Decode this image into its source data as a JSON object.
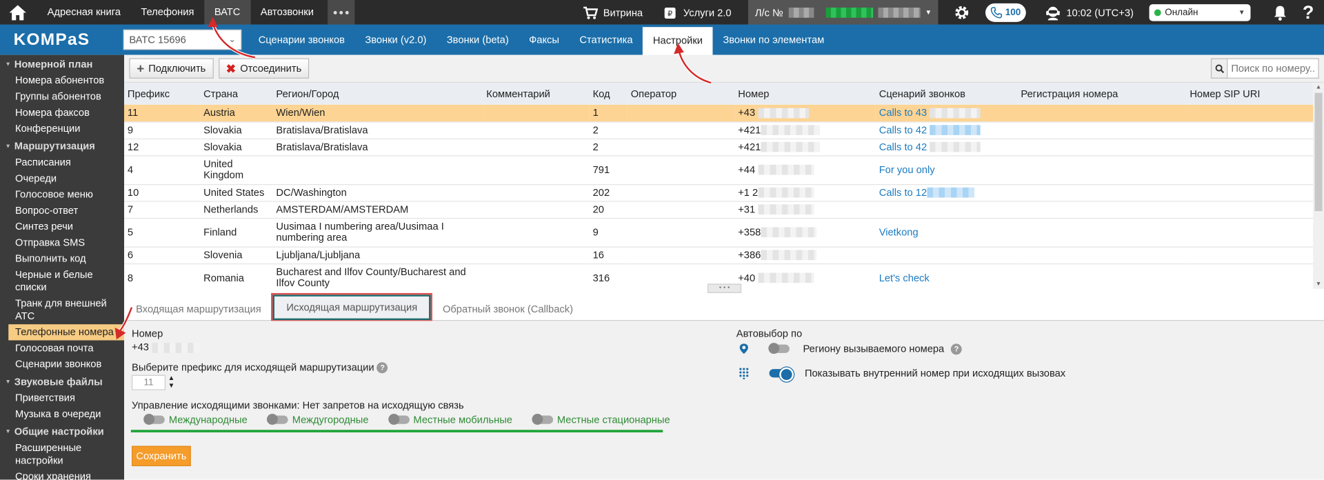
{
  "topbar": {
    "nav": [
      "Адресная книга",
      "Телефония",
      "ВАТС",
      "Автозвонки"
    ],
    "active_nav": "ВАТС",
    "vitrina": "Витрина",
    "services": "Услуги 2.0",
    "account_label": "Л/с №",
    "calls_count": "100",
    "time": "10:02 (UTC+3)",
    "status": "Онлайн"
  },
  "secbar": {
    "logo": "KOMPaS",
    "vatc_select": "ВАТС 15696",
    "tabs": [
      "Сценарии звонков",
      "Звонки (v2.0)",
      "Звонки (beta)",
      "Факсы",
      "Статистика",
      "Настройки",
      "Звонки по элементам"
    ],
    "active_tab": "Настройки"
  },
  "sidebar": {
    "sections": [
      {
        "title": "Номерной план",
        "items": [
          "Номера абонентов",
          "Группы абонентов",
          "Номера факсов",
          "Конференции"
        ]
      },
      {
        "title": "Маршрутизация",
        "items": [
          "Расписания",
          "Очереди",
          "Голосовое меню",
          "Вопрос-ответ",
          "Синтез речи",
          "Отправка SMS",
          "Выполнить код",
          "Черные и белые списки",
          "Транк для внешней АТС",
          "Телефонные номера",
          "Голосовая почта",
          "Сценарии звонков"
        ]
      },
      {
        "title": "Звуковые файлы",
        "items": [
          "Приветствия",
          "Музыка в очереди"
        ]
      },
      {
        "title": "Общие настройки",
        "items": [
          "Расширенные настройки",
          "Сроки хранения"
        ]
      }
    ],
    "active_item": "Телефонные номера"
  },
  "toolbar": {
    "connect": "Подключить",
    "disconnect": "Отсоединить",
    "search_placeholder": "Поиск по номеру..."
  },
  "table": {
    "columns": [
      "Префикс",
      "Страна",
      "Регион/Город",
      "Комментарий",
      "Код",
      "Оператор",
      "Номер",
      "Сценарий звонков",
      "Регистрация номера",
      "Номер SIP URI"
    ],
    "rows": [
      {
        "prefix": "11",
        "country": "Austria",
        "region": "Wien/Wien",
        "comment": "",
        "code": "1",
        "operator": "",
        "number": "+43",
        "scenario": "Calls to 43",
        "selected": true
      },
      {
        "prefix": "9",
        "country": "Slovakia",
        "region": "Bratislava/Bratislava",
        "comment": "",
        "code": "2",
        "operator": "",
        "number": "+421",
        "scenario": "Calls to 42",
        "selected": false
      },
      {
        "prefix": "12",
        "country": "Slovakia",
        "region": "Bratislava/Bratislava",
        "comment": "",
        "code": "2",
        "operator": "",
        "number": "+421",
        "scenario": "Calls to 42",
        "selected": false
      },
      {
        "prefix": "4",
        "country": "United Kingdom",
        "region": "",
        "comment": "",
        "code": "791",
        "operator": "",
        "number": "+44",
        "scenario": "For you only",
        "selected": false
      },
      {
        "prefix": "10",
        "country": "United States",
        "region": "DC/Washington",
        "comment": "",
        "code": "202",
        "operator": "",
        "number": "+1 2",
        "scenario": "Calls to 12",
        "selected": false
      },
      {
        "prefix": "7",
        "country": "Netherlands",
        "region": "AMSTERDAM/AMSTERDAM",
        "comment": "",
        "code": "20",
        "operator": "",
        "number": "+31",
        "scenario": "",
        "selected": false
      },
      {
        "prefix": "5",
        "country": "Finland",
        "region": "Uusimaa I numbering area/Uusimaa I numbering area",
        "comment": "",
        "code": "9",
        "operator": "",
        "number": "+358",
        "scenario": "Vietkong",
        "selected": false
      },
      {
        "prefix": "6",
        "country": "Slovenia",
        "region": "Ljubljana/Ljubljana",
        "comment": "",
        "code": "16",
        "operator": "",
        "number": "+386",
        "scenario": "",
        "selected": false
      },
      {
        "prefix": "8",
        "country": "Romania",
        "region": "Bucharest and Ilfov County/Bucharest and Ilfov County",
        "comment": "",
        "code": "316",
        "operator": "",
        "number": "+40",
        "scenario": "Let's check",
        "selected": false
      }
    ]
  },
  "tabs": {
    "items": [
      "Входящая маршрутизация",
      "Исходящая маршрутизация",
      "Обратный звонок (Callback)"
    ],
    "active": "Исходящая маршрутизация"
  },
  "form": {
    "number_label": "Номер",
    "number_value": "+43",
    "prefix_label": "Выберите префикс для исходящей маршрутизации",
    "prefix_value": "11",
    "control_label": "Управление исходящими звонками: Нет запретов на исходящую связь",
    "restrictions": [
      "Международные",
      "Междугородные",
      "Местные мобильные",
      "Местные стационарные"
    ],
    "autoselect_label": "Автовыбор по",
    "autoselect_region": "Региону вызываемого номера",
    "show_internal": "Показывать внутренний номер при исходящих вызовах",
    "save": "Сохранить"
  },
  "colors": {
    "accent": "#1b6ea9",
    "selected_row": "#fdd493",
    "save": "#f59c2a",
    "link": "#1b7bc2"
  }
}
